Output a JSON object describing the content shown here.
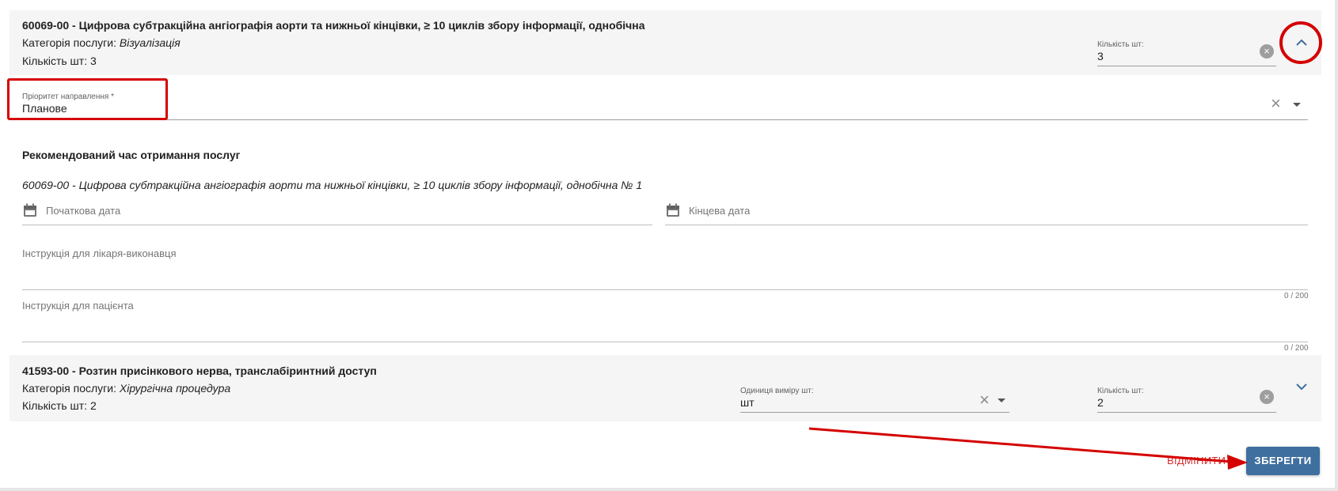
{
  "service1": {
    "title": "60069-00 - Цифрова субтракційна ангіографія аорти та нижньої кінцівки, ≥ 10 циклів збору інформації, однобічна",
    "category_label": "Категорія послуги:",
    "category_value": "Візуалізація",
    "quantity_text": "Кількість шт: 3",
    "quantity_field_label": "Кількість шт:",
    "quantity_field_value": "3"
  },
  "priority": {
    "label": "Пріоритет направлення *",
    "value": "Планове"
  },
  "recommended_time": {
    "heading": "Рекомендований час отримання послуг",
    "service_name": "60069-00 - Цифрова субтракційна ангіографія аорти та нижньої кінцівки, ≥ 10 циклів збору інформації, однобічна № 1",
    "start_date_placeholder": "Початкова дата",
    "end_date_placeholder": "Кінцева дата"
  },
  "instructions": {
    "doctor_placeholder": "Інструкція для лікаря-виконавця",
    "doctor_counter": "0 / 200",
    "patient_placeholder": "Інструкція для пацієнта",
    "patient_counter": "0 / 200"
  },
  "service2": {
    "title": "41593-00 - Розтин присінкового нерва, транслабіринтний доступ",
    "category_label": "Категорія послуги:",
    "category_value": "Хірургічна процедура",
    "quantity_text": "Кількість шт: 2",
    "unit_field_label": "Одиниця виміру шт:",
    "unit_field_value": "шт",
    "quantity_field_label": "Кількість шт:",
    "quantity_field_value": "2"
  },
  "actions": {
    "cancel_label": "ВІДМІНИТИ",
    "save_label": "ЗБЕРЕГТИ"
  },
  "icons": {
    "clear_circle": "×",
    "clear_x": "×"
  },
  "colors": {
    "accent": "#3f6f9e",
    "highlight": "#d50000",
    "cancel_text": "#d32f2f",
    "panel_bg": "#f5f5f5"
  }
}
